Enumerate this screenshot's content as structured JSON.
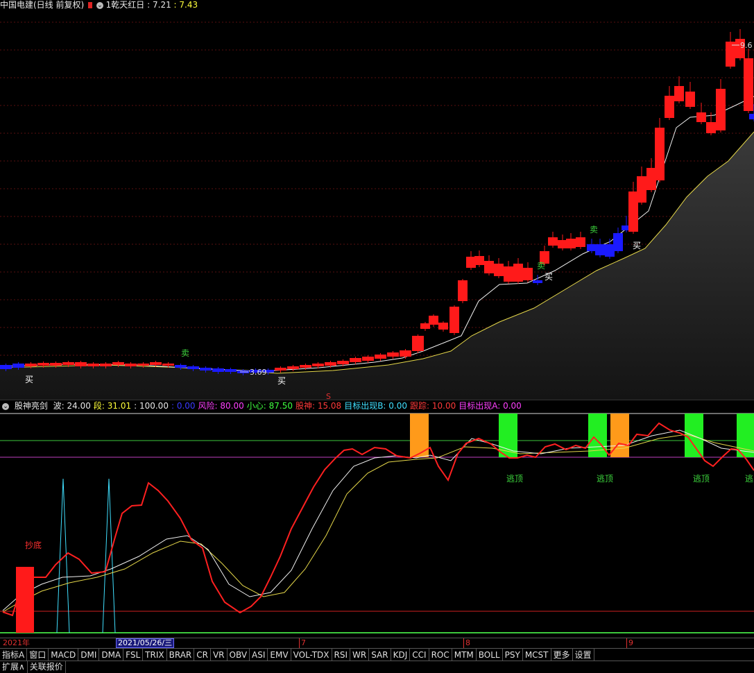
{
  "header": {
    "stock_name": "中国电建(日线 前复权)",
    "indicator_name": "1乾天红日",
    "value1": "7.21",
    "value2": "7.43"
  },
  "price_chart": {
    "high_label": "9.6",
    "low_label": "3.69",
    "markers": {
      "buy": "买",
      "sell": "卖",
      "s_mark": "S"
    }
  },
  "indicator_panel": {
    "name": "股神亮剑",
    "items": [
      {
        "label": "波",
        "value": "24.00",
        "color": "#e8e8e8"
      },
      {
        "label": "段",
        "value": "31.01",
        "color": "#ffff3a"
      },
      {
        "label": "",
        "value": "100.00",
        "color": "#e8e8e8"
      },
      {
        "label": "",
        "value": "0.00",
        "color": "#3a3aff"
      },
      {
        "label": "风险",
        "value": "80.00",
        "color": "#ff40ff"
      },
      {
        "label": "小心",
        "value": "87.50",
        "color": "#40ff40"
      },
      {
        "label": "股神",
        "value": "15.08",
        "color": "#ff3a3a"
      },
      {
        "label": "目标出现B",
        "value": "0.00",
        "color": "#40e0ff"
      },
      {
        "label": "跟踪",
        "value": "10.00",
        "color": "#ff3a3a"
      },
      {
        "label": "目标出现A",
        "value": "0.00",
        "color": "#ff40ff"
      }
    ],
    "bottom_label": "抄底",
    "top_label": "逃顶",
    "top_label_cut": "逃"
  },
  "date_axis": {
    "year": "2021年",
    "cursor_date": "2021/05/26/三",
    "m7": "7",
    "m8": "8",
    "m9": "9"
  },
  "tabs": [
    "指标A",
    "窗口",
    "MACD",
    "DMI",
    "DMA",
    "FSL",
    "TRIX",
    "BRAR",
    "CR",
    "VR",
    "OBV",
    "ASI",
    "EMV",
    "VOL-TDX",
    "RSI",
    "WR",
    "SAR",
    "KDJ",
    "CCI",
    "ROC",
    "MTM",
    "BOLL",
    "PSY",
    "MCST",
    "更多",
    "设置"
  ],
  "bottom_tabs": [
    "扩展∧",
    "关联报价"
  ]
}
